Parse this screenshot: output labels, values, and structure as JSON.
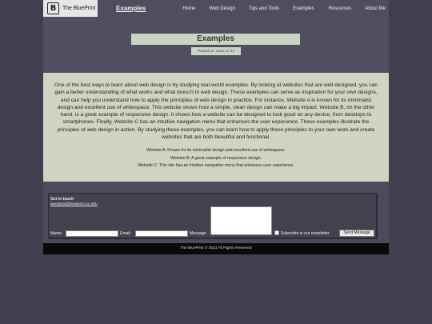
{
  "nav": {
    "logo_mark": "B",
    "logo_text": "The BluePrint",
    "title": "Examples",
    "links": [
      "Home",
      "Web Design",
      "Tips and Tools",
      "Examples",
      "Resources",
      "About Me"
    ]
  },
  "hero": {
    "title": "Examples",
    "date": "Posted on: 2023-12-13"
  },
  "content": {
    "intro": "One of the best ways to learn about web design is by studying real-world examples. By looking at websites that are well-designed, you can gain a better understanding of what works and what doesn't in web design. These examples can serve as inspiration for your own designs, and can help you understand how to apply the principles of web design in practice. For instance, Website A is known for its minimalist design and excellent use of whitespace. This website shows how a simple, clean design can make a big impact. Website B, on the other hand, is a great example of responsive design. It shows how a website can be designed to look good on any device, from desktops to smartphones. Finally, Website C has an intuitive navigation menu that enhances the user experience. These examples illustrate the principles of web design in action. By studying these examples, you can learn how to apply these principles to your own work and create websites that are both beautiful and functional.",
    "examples": [
      "Website A: Known for its minimalist design and excellent use of whitespace.",
      "Website B: A great example of responsive design.",
      "Website C: This site has an intuitive navigation menu that enhances user experience."
    ]
  },
  "contact": {
    "title": "Get in touch",
    "email": "aweyland@student.ccc.edu",
    "name_label": "Name:",
    "email_label": "Email:",
    "message_label": "Message:",
    "subscribe_label": "Subscribe to our newsletter",
    "send_label": "Send Message"
  },
  "footer": {
    "text": "The BluePrint © 2023 All Rights Reserved"
  }
}
